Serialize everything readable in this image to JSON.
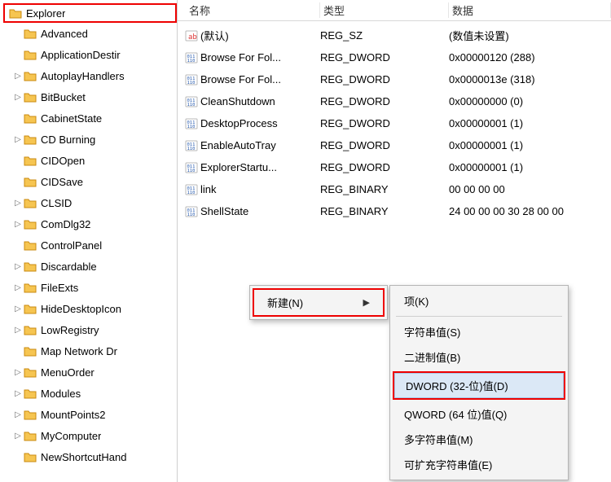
{
  "tree": {
    "root": "Explorer",
    "items": [
      {
        "label": "Advanced",
        "expander": ""
      },
      {
        "label": "ApplicationDestir",
        "expander": ""
      },
      {
        "label": "AutoplayHandlers",
        "expander": "▷"
      },
      {
        "label": "BitBucket",
        "expander": "▷"
      },
      {
        "label": "CabinetState",
        "expander": ""
      },
      {
        "label": "CD Burning",
        "expander": "▷"
      },
      {
        "label": "CIDOpen",
        "expander": ""
      },
      {
        "label": "CIDSave",
        "expander": ""
      },
      {
        "label": "CLSID",
        "expander": "▷"
      },
      {
        "label": "ComDlg32",
        "expander": "▷"
      },
      {
        "label": "ControlPanel",
        "expander": ""
      },
      {
        "label": "Discardable",
        "expander": "▷"
      },
      {
        "label": "FileExts",
        "expander": "▷"
      },
      {
        "label": "HideDesktopIcon",
        "expander": "▷"
      },
      {
        "label": "LowRegistry",
        "expander": "▷"
      },
      {
        "label": "Map Network Dr",
        "expander": ""
      },
      {
        "label": "MenuOrder",
        "expander": "▷"
      },
      {
        "label": "Modules",
        "expander": "▷"
      },
      {
        "label": "MountPoints2",
        "expander": "▷"
      },
      {
        "label": "MyComputer",
        "expander": "▷"
      },
      {
        "label": "NewShortcutHand",
        "expander": ""
      }
    ]
  },
  "columns": {
    "name": "名称",
    "type": "类型",
    "data": "数据"
  },
  "rows": [
    {
      "icon": "sz",
      "name": "(默认)",
      "type": "REG_SZ",
      "data": "(数值未设置)"
    },
    {
      "icon": "dw",
      "name": "Browse For Fol...",
      "type": "REG_DWORD",
      "data": "0x00000120 (288)"
    },
    {
      "icon": "dw",
      "name": "Browse For Fol...",
      "type": "REG_DWORD",
      "data": "0x0000013e (318)"
    },
    {
      "icon": "dw",
      "name": "CleanShutdown",
      "type": "REG_DWORD",
      "data": "0x00000000 (0)"
    },
    {
      "icon": "dw",
      "name": "DesktopProcess",
      "type": "REG_DWORD",
      "data": "0x00000001 (1)"
    },
    {
      "icon": "dw",
      "name": "EnableAutoTray",
      "type": "REG_DWORD",
      "data": "0x00000001 (1)"
    },
    {
      "icon": "dw",
      "name": "ExplorerStartu...",
      "type": "REG_DWORD",
      "data": "0x00000001 (1)"
    },
    {
      "icon": "dw",
      "name": "link",
      "type": "REG_BINARY",
      "data": "00 00 00 00"
    },
    {
      "icon": "dw",
      "name": "ShellState",
      "type": "REG_BINARY",
      "data": "24 00 00 00 30 28 00 00"
    }
  ],
  "menu_new": {
    "label": "新建(N)",
    "arrow": "▶"
  },
  "submenu": [
    {
      "label": "项(K)",
      "hl": false,
      "box": false
    },
    {
      "label": "字符串值(S)",
      "hl": false,
      "box": false
    },
    {
      "label": "二进制值(B)",
      "hl": false,
      "box": false
    },
    {
      "label": "DWORD (32-位)值(D)",
      "hl": true,
      "box": true
    },
    {
      "label": "QWORD (64 位)值(Q)",
      "hl": false,
      "box": false
    },
    {
      "label": "多字符串值(M)",
      "hl": false,
      "box": false
    },
    {
      "label": "可扩充字符串值(E)",
      "hl": false,
      "box": false
    }
  ]
}
